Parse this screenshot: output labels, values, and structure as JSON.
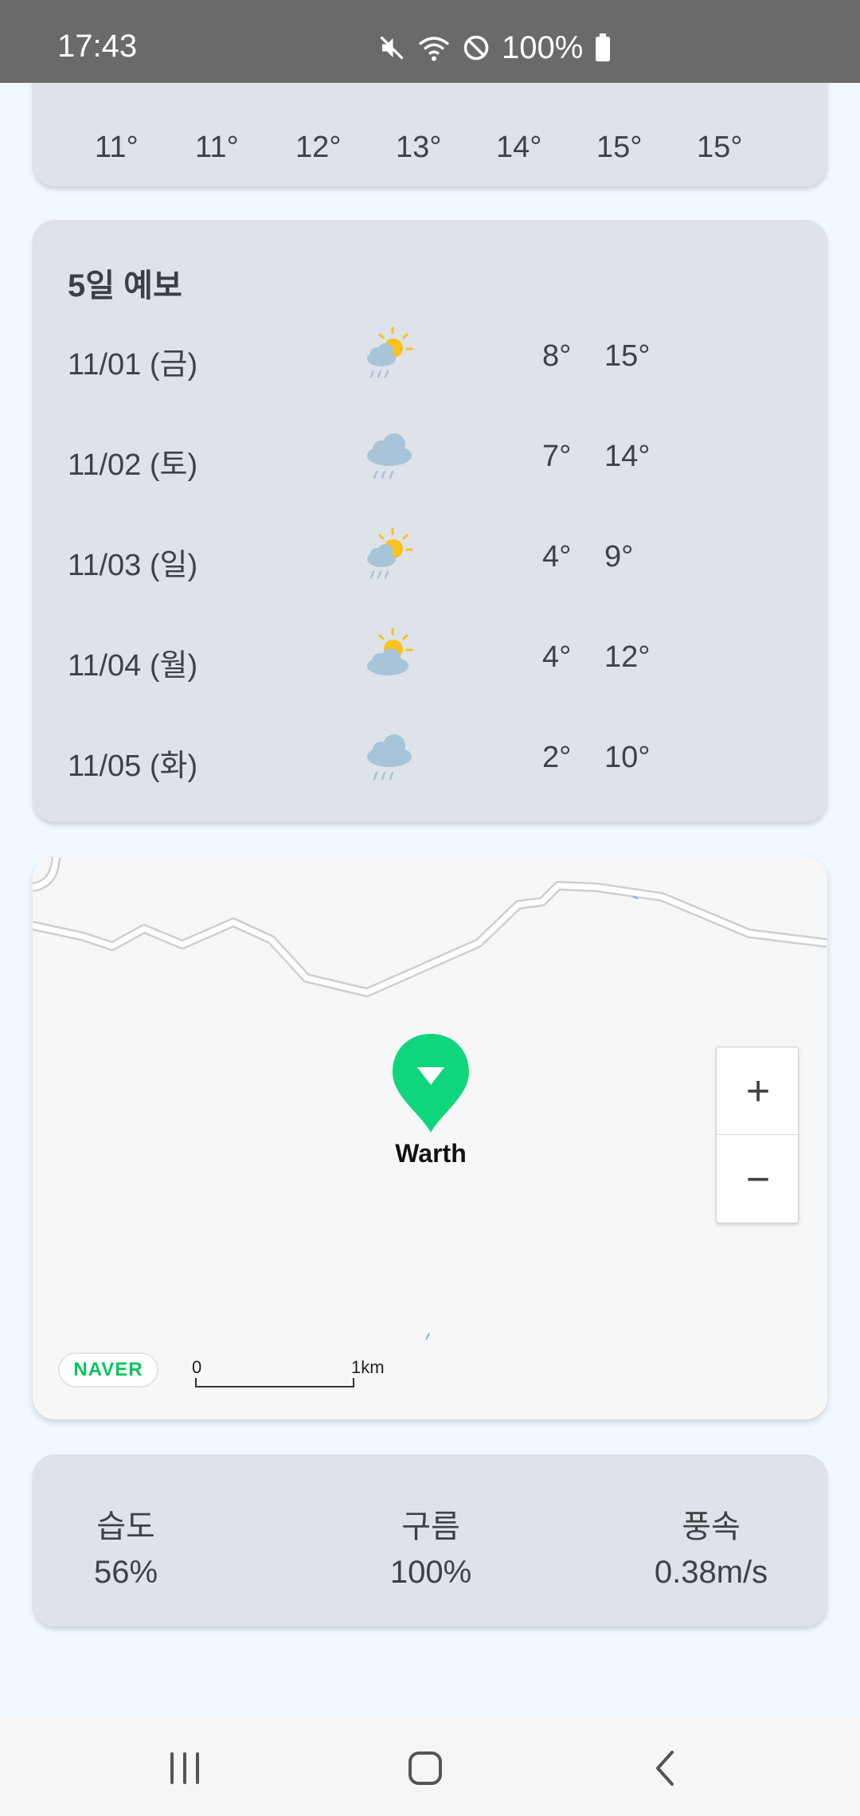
{
  "status_bar": {
    "time": "17:43",
    "battery": "100%",
    "icons": [
      "mute-icon",
      "wifi-icon",
      "do-not-disturb-icon",
      "battery-icon"
    ]
  },
  "hourly": {
    "temps": [
      "11°",
      "11°",
      "12°",
      "13°",
      "14°",
      "15°",
      "15°"
    ]
  },
  "forecast": {
    "title": "5일 예보",
    "days": [
      {
        "date": "11/01 (금)",
        "icon": "sun-rain-icon",
        "low": "8°",
        "high": "15°"
      },
      {
        "date": "11/02 (토)",
        "icon": "rain-cloud-icon",
        "low": "7°",
        "high": "14°"
      },
      {
        "date": "11/03 (일)",
        "icon": "sun-rain-icon",
        "low": "4°",
        "high": "9°"
      },
      {
        "date": "11/04 (월)",
        "icon": "sun-cloud-icon",
        "low": "4°",
        "high": "12°"
      },
      {
        "date": "11/05 (화)",
        "icon": "rain-cloud-icon",
        "low": "2°",
        "high": "10°"
      }
    ]
  },
  "map": {
    "marker_label": "Warth",
    "zoom_in": "+",
    "zoom_out": "−",
    "logo": "NAVER",
    "scale_zero": "0",
    "scale_unit": "1km",
    "marker_color": "#0fd67c"
  },
  "details": {
    "humidity_label": "습도",
    "humidity_value": "56%",
    "cloud_label": "구름",
    "cloud_value": "100%",
    "wind_label": "풍속",
    "wind_value": "0.38m/s"
  }
}
